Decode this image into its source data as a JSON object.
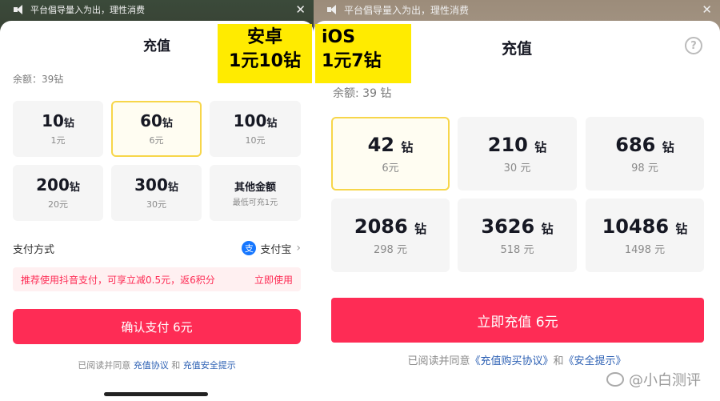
{
  "android": {
    "notice": "平台倡导量入为出，理性消费",
    "title": "充值",
    "balance": "余额：39钻",
    "packages": [
      {
        "amount": "10",
        "unit": "钻",
        "price": "1元"
      },
      {
        "amount": "60",
        "unit": "钻",
        "price": "6元"
      },
      {
        "amount": "100",
        "unit": "钻",
        "price": "10元"
      },
      {
        "amount": "200",
        "unit": "钻",
        "price": "20元"
      },
      {
        "amount": "300",
        "unit": "钻",
        "price": "30元"
      }
    ],
    "other": {
      "label": "其他金额",
      "sub": "最低可充1元"
    },
    "pay_method_label": "支付方式",
    "alipay_icon_char": "支",
    "pay_method_value": "支付宝",
    "promo_text": "推荐使用抖音支付，可享立减0.5元，返6积分",
    "promo_action": "立即使用",
    "confirm": "确认支付 6元",
    "agree_prefix": "已阅读并同意",
    "agree_link1": "充值协议",
    "agree_and": "和",
    "agree_link2": "充值安全提示"
  },
  "ios": {
    "notice": "平台倡导量入为出，理性消费",
    "title": "充值",
    "help": "?",
    "balance": "余额: 39 钻",
    "packages": [
      {
        "amount": "42",
        "unit": "钻",
        "price": "6元"
      },
      {
        "amount": "210",
        "unit": "钻",
        "price": "30 元"
      },
      {
        "amount": "686",
        "unit": "钻",
        "price": "98 元"
      },
      {
        "amount": "2086",
        "unit": "钻",
        "price": "298 元"
      },
      {
        "amount": "3626",
        "unit": "钻",
        "price": "518 元"
      },
      {
        "amount": "10486",
        "unit": "钻",
        "price": "1498 元"
      }
    ],
    "confirm": "立即充值 6元",
    "agree_prefix": "已阅读并同意",
    "agree_link1": "《充值购买协议》",
    "agree_and": "和",
    "agree_link2": "《安全提示》"
  },
  "tags": {
    "android_line1": "安卓",
    "android_line2": "1元10钻",
    "ios_line1": "iOS",
    "ios_line2": "1元7钻"
  },
  "watermark": "@小白测评",
  "colors": {
    "accent": "#fe2c55",
    "highlight": "#ffeb00",
    "selected_border": "#f7d64a"
  }
}
